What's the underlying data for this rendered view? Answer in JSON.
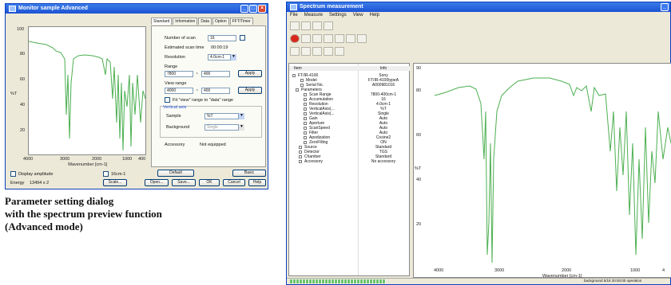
{
  "left_dialog": {
    "title": "Monitor sample Advanced",
    "plot": {
      "y_ticks": [
        "100",
        "80",
        "60",
        "40",
        "20"
      ],
      "y_label": "%T",
      "x_ticks": [
        "4000",
        "3000",
        "2000",
        "1000",
        "400"
      ],
      "x_label": "Wavenumber [cm-1]"
    },
    "tabs": [
      "Standard",
      "Information",
      "Data",
      "Option",
      "FFT/Timer"
    ],
    "fields": {
      "num_scan_label": "Number of scan",
      "num_scan_value": "16",
      "est_time_label": "Estimated scan time",
      "est_time_value": "00:00:19",
      "resolution_label": "Resolution",
      "resolution_value": "4.0cm-1",
      "range_label": "Range",
      "range_from": "7800",
      "range_to": "400",
      "view_range_label": "View range",
      "view_from": "4000",
      "view_to": "400",
      "separator": "~",
      "fit_label": "Fit \"view\" range to \"data\" range",
      "vertical_axis_label": "Vertical axis",
      "sample_label": "Sample",
      "sample_value": "%T",
      "background_label": "Background",
      "background_value": "Single",
      "accessory_label": "Accessory",
      "accessory_value": "Not equipped"
    },
    "buttons": {
      "apply1": "Apply",
      "apply2": "Apply",
      "default": "Default",
      "basic": "Basic",
      "scale": "Scale...",
      "open": "Open...",
      "save": "Save...",
      "ok": "OK",
      "cancel": "Cancel",
      "help": "Help"
    },
    "bottom": {
      "display_amplitude": "Display amplitude",
      "energy_label": "Energy",
      "energy_value": "13494 x 2",
      "res_check": "16cm-1"
    }
  },
  "caption": {
    "line1": "Parameter setting dialog",
    "line2": "with the spectrum preview function",
    "line3": "(Advanced mode)"
  },
  "right_window": {
    "title": "Spectrum measurement",
    "menu": [
      "File",
      "Measure",
      "Settings",
      "View",
      "Help"
    ],
    "tree_headers": {
      "item": "Item",
      "info": "Info"
    },
    "tree_rows": [
      {
        "name": "FT/IR-4100",
        "info": "Sony"
      },
      {
        "name": "Model",
        "info": "FT/IR-4100typeA"
      },
      {
        "name": "Serial No.",
        "info": "A000981016"
      },
      {
        "name": "Parameters",
        "info": ""
      },
      {
        "name": "Scan Range",
        "info": "7800-400cm-1"
      },
      {
        "name": "Accumulation",
        "info": "16"
      },
      {
        "name": "Resolution",
        "info": "4.0cm-1"
      },
      {
        "name": "VerticalAxis(...",
        "info": "%T"
      },
      {
        "name": "VerticalAxis(...",
        "info": "Single"
      },
      {
        "name": "Gain",
        "info": "Auto"
      },
      {
        "name": "Aperture",
        "info": "Auto"
      },
      {
        "name": "ScanSpeed",
        "info": "Auto"
      },
      {
        "name": "Filter",
        "info": "Auto"
      },
      {
        "name": "Apodization",
        "info": "Cosine2"
      },
      {
        "name": "ZeroFilling",
        "info": "ON"
      },
      {
        "name": "Source",
        "info": "Standard"
      },
      {
        "name": "Detector",
        "info": "TGS"
      },
      {
        "name": "Chamber",
        "info": "Standard"
      },
      {
        "name": "Accessory",
        "info": "No accessory"
      }
    ],
    "plot": {
      "y_ticks": [
        "90",
        "80",
        "60",
        "40",
        "20"
      ],
      "y_label": "%T",
      "x_ticks": [
        "4000",
        "3000",
        "2000",
        "1000",
        "4"
      ],
      "x_label": "Wavenumber [cm-1]"
    },
    "status": "background  5/18 20:00:00 operation"
  },
  "colors": {
    "spectrum": "#4caf50",
    "titlebar": "#1c52d4",
    "stop": "#d9261c"
  }
}
